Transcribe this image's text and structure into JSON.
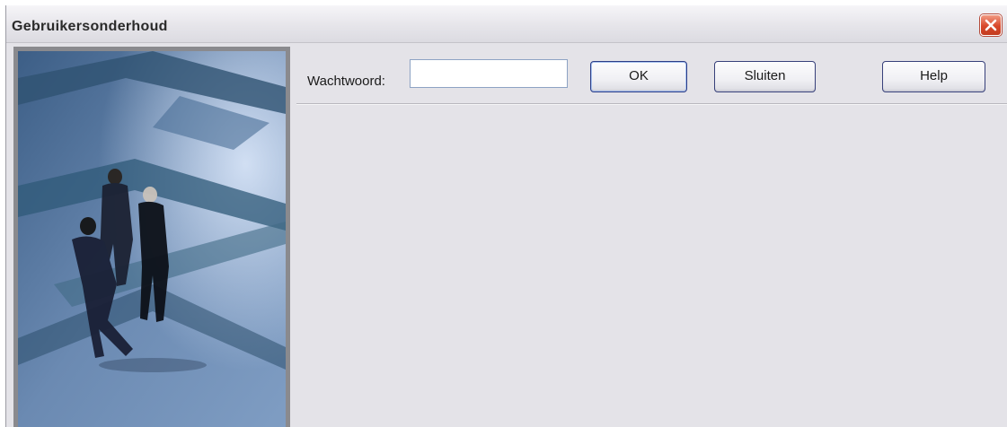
{
  "window": {
    "title": "Gebruikersonderhoud",
    "close_icon": "close-icon"
  },
  "form": {
    "password_label": "Wachtwoord:",
    "password_value": "",
    "password_placeholder": ""
  },
  "buttons": {
    "ok_label": "OK",
    "close_label": "Sluiten",
    "help_label": "Help"
  },
  "colors": {
    "window_bg": "#e4e3e8",
    "close_button": "#d8482a",
    "button_border": "#37407a"
  }
}
